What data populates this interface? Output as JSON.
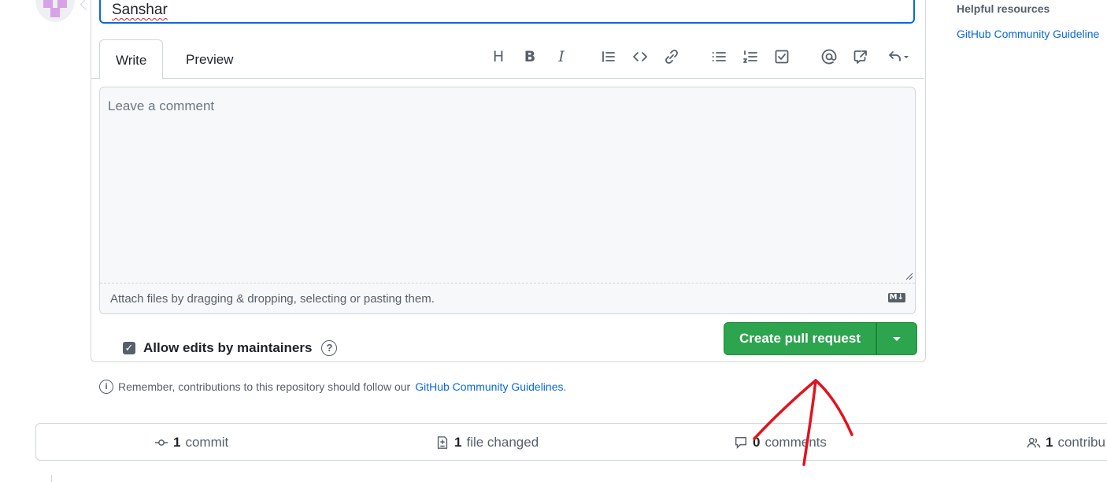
{
  "title_input": {
    "value": "Sanshar"
  },
  "tabs": [
    {
      "label": "Write"
    },
    {
      "label": "Preview"
    }
  ],
  "toolbar": [
    {
      "name": "heading-icon",
      "glyph": "H"
    },
    {
      "name": "bold-icon",
      "glyph": "B"
    },
    {
      "name": "italic-icon",
      "glyph": "I"
    },
    {
      "name": "quote-icon"
    },
    {
      "name": "code-icon"
    },
    {
      "name": "link-icon"
    },
    {
      "name": "unordered-list-icon"
    },
    {
      "name": "ordered-list-icon"
    },
    {
      "name": "task-list-icon"
    },
    {
      "name": "mention-icon"
    },
    {
      "name": "cross-reference-icon"
    },
    {
      "name": "saved-reply-icon"
    }
  ],
  "comment": {
    "placeholder": "Leave a comment",
    "attach_text": "Attach files by dragging & dropping, selecting or pasting them.",
    "markdown_badge": "M↓"
  },
  "maintainer_edits": {
    "label": "Allow edits by maintainers",
    "checked": true
  },
  "create_button": {
    "label": "Create pull request"
  },
  "reminder": {
    "prefix": "Remember, contributions to this repository should follow our",
    "link": "GitHub Community Guidelines",
    "suffix": "."
  },
  "stats": {
    "commits": {
      "count": "1",
      "label": "commit"
    },
    "files": {
      "count": "1",
      "label": "file changed"
    },
    "comments": {
      "count": "0",
      "label": "comments"
    },
    "contributors": {
      "count": "1",
      "label": "contribu"
    }
  },
  "sidebar": {
    "heading": "Helpful resources",
    "link": "GitHub Community Guideline"
  },
  "colors": {
    "primary_button": "#2da44e",
    "link": "#0969da",
    "annotation": "#e0141e"
  }
}
